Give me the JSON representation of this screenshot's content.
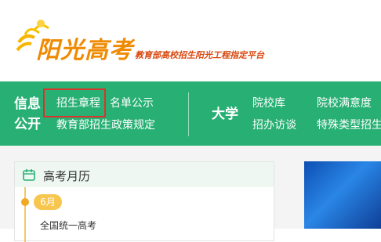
{
  "logo": {
    "title": "阳光高考",
    "subtitle": "教育部高校招生阳光工程指定平台"
  },
  "nav": {
    "info_title_line1": "信息",
    "info_title_line2": "公开",
    "info_links": [
      "招生章程",
      "名单公示",
      "教育部招生政策规定"
    ],
    "univ_title": "大学",
    "univ_links": [
      "院校库",
      "院校满意度",
      "招办访谈",
      "特殊类型招生"
    ]
  },
  "calendar": {
    "title": "高考月历",
    "month": "6月",
    "event": "全国统一高考"
  },
  "colors": {
    "nav_bg": "#28b074",
    "logo_orange": "#f08a00",
    "highlight": "#d9342b"
  }
}
